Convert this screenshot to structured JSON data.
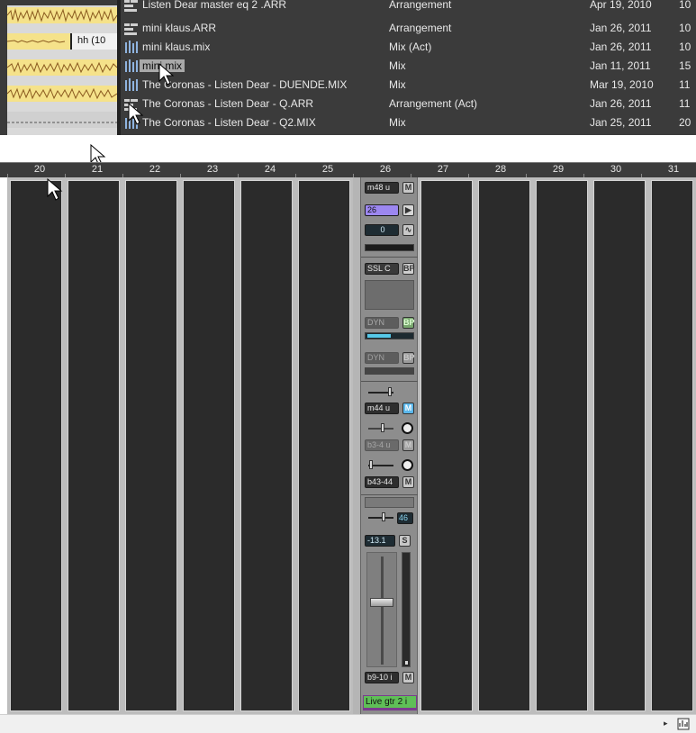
{
  "browser": {
    "lanes": {
      "clip_label": "hh (10"
    },
    "files": [
      {
        "name": "Listen Dear master eq 2 .ARR",
        "type": "Arrangement",
        "date": "Apr 19, 2010",
        "time": "10",
        "icon": "arrangement-icon"
      },
      {
        "name": "mini klaus.ARR",
        "type": "Arrangement",
        "date": "Jan 26, 2011",
        "time": "10",
        "icon": "arrangement-icon"
      },
      {
        "name": "mini klaus.mix",
        "type": "Mix (Act)",
        "date": "Jan 26, 2011",
        "time": "10",
        "icon": "mix-icon"
      },
      {
        "name": "mini.mix",
        "type": "Mix",
        "date": "Jan 11, 2011",
        "time": "15",
        "icon": "mix-icon",
        "selected": true
      },
      {
        "name": "The Coronas - Listen Dear - DUENDE.MIX",
        "type": "Mix",
        "date": "Mar 19, 2010",
        "time": "11",
        "icon": "mix-icon"
      },
      {
        "name": "The Coronas - Listen Dear - Q.ARR",
        "type": "Arrangement (Act)",
        "date": "Jan 26, 2011",
        "time": "11",
        "icon": "arrangement-icon"
      },
      {
        "name": "The Coronas - Listen Dear - Q2.MIX",
        "type": "Mix",
        "date": "Jan 25, 2011",
        "time": "20",
        "icon": "mix-icon"
      }
    ]
  },
  "ruler": {
    "numbers": [
      "20",
      "21",
      "22",
      "23",
      "24",
      "25",
      "26",
      "27",
      "28",
      "29",
      "30",
      "31"
    ]
  },
  "strip26": {
    "input": "m48 u",
    "input_btn": "M",
    "track_number": "26",
    "play_btn": "▶",
    "value": "0",
    "wave_btn": "∿",
    "eq": "SSL C",
    "eq_btn": "BP",
    "dyn1": "DYN",
    "dyn1_btn": "BP",
    "dyn2": "DYN",
    "dyn2_btn": "BP",
    "send1": "m44 u",
    "send1_btn": "M",
    "send2": "b3-4 u",
    "send2_btn": "M",
    "send3": "b43-44",
    "send3_btn": "M",
    "pan_value": "46",
    "fader_db": "-13.1",
    "solo_btn": "S",
    "output": "b9-10 i",
    "output_btn": "M",
    "track_name": "Live gtr 2 i"
  },
  "colors": {
    "track_color": "#9c87f0",
    "name_color": "#5fbf57",
    "meter": "#56c8e8",
    "clip_yellow": "#f5e28a"
  }
}
